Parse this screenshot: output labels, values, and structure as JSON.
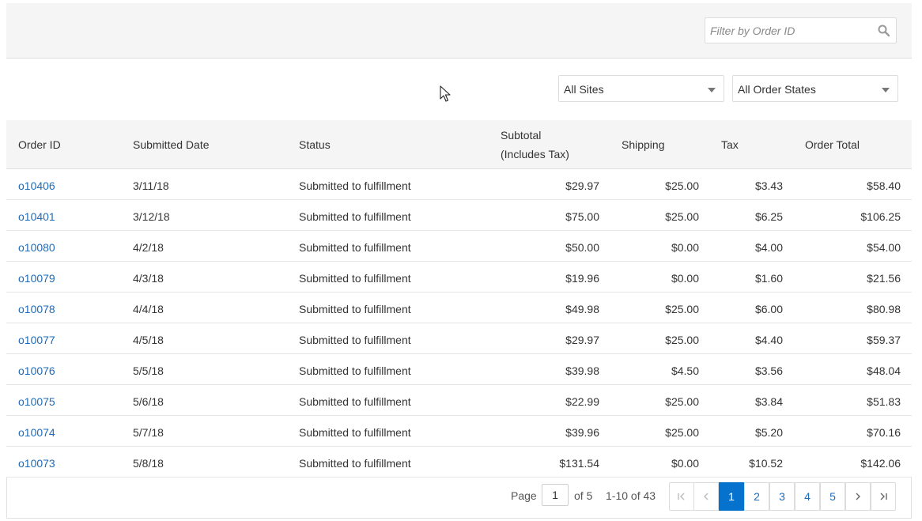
{
  "filter": {
    "placeholder": "Filter by Order ID"
  },
  "sites_select": {
    "value": "All Sites"
  },
  "states_select": {
    "value": "All Order States"
  },
  "table": {
    "headers": {
      "order_id": "Order ID",
      "submitted_date": "Submitted Date",
      "status": "Status",
      "subtotal_line1": "Subtotal",
      "subtotal_line2": "(Includes Tax)",
      "shipping": "Shipping",
      "tax": "Tax",
      "order_total": "Order Total"
    },
    "rows": [
      {
        "id": "o10406",
        "date": "3/11/18",
        "status": "Submitted to fulfillment",
        "subtotal": "$29.97",
        "shipping": "$25.00",
        "tax": "$3.43",
        "total": "$58.40"
      },
      {
        "id": "o10401",
        "date": "3/12/18",
        "status": "Submitted to fulfillment",
        "subtotal": "$75.00",
        "shipping": "$25.00",
        "tax": "$6.25",
        "total": "$106.25"
      },
      {
        "id": "o10080",
        "date": "4/2/18",
        "status": "Submitted to fulfillment",
        "subtotal": "$50.00",
        "shipping": "$0.00",
        "tax": "$4.00",
        "total": "$54.00"
      },
      {
        "id": "o10079",
        "date": "4/3/18",
        "status": "Submitted to fulfillment",
        "subtotal": "$19.96",
        "shipping": "$0.00",
        "tax": "$1.60",
        "total": "$21.56"
      },
      {
        "id": "o10078",
        "date": "4/4/18",
        "status": "Submitted to fulfillment",
        "subtotal": "$49.98",
        "shipping": "$25.00",
        "tax": "$6.00",
        "total": "$80.98"
      },
      {
        "id": "o10077",
        "date": "4/5/18",
        "status": "Submitted to fulfillment",
        "subtotal": "$29.97",
        "shipping": "$25.00",
        "tax": "$4.40",
        "total": "$59.37"
      },
      {
        "id": "o10076",
        "date": "5/5/18",
        "status": "Submitted to fulfillment",
        "subtotal": "$39.98",
        "shipping": "$4.50",
        "tax": "$3.56",
        "total": "$48.04"
      },
      {
        "id": "o10075",
        "date": "5/6/18",
        "status": "Submitted to fulfillment",
        "subtotal": "$22.99",
        "shipping": "$25.00",
        "tax": "$3.84",
        "total": "$51.83"
      },
      {
        "id": "o10074",
        "date": "5/7/18",
        "status": "Submitted to fulfillment",
        "subtotal": "$39.96",
        "shipping": "$25.00",
        "tax": "$5.20",
        "total": "$70.16"
      },
      {
        "id": "o10073",
        "date": "5/8/18",
        "status": "Submitted to fulfillment",
        "subtotal": "$131.54",
        "shipping": "$0.00",
        "tax": "$10.52",
        "total": "$142.06"
      }
    ]
  },
  "pagination": {
    "page_label": "Page",
    "current_page": "1",
    "of_label": "of 5",
    "range_label": "1-10 of 43",
    "pages": [
      "1",
      "2",
      "3",
      "4",
      "5"
    ]
  },
  "icons": {
    "search": "search-icon",
    "first_page": "first-page-icon",
    "prev_page": "chevron-left-icon",
    "next_page": "chevron-right-icon",
    "last_page": "last-page-icon"
  },
  "colors": {
    "link": "#1f6bb8",
    "active_page": "#0572ce",
    "header_bg": "#f5f5f5"
  }
}
